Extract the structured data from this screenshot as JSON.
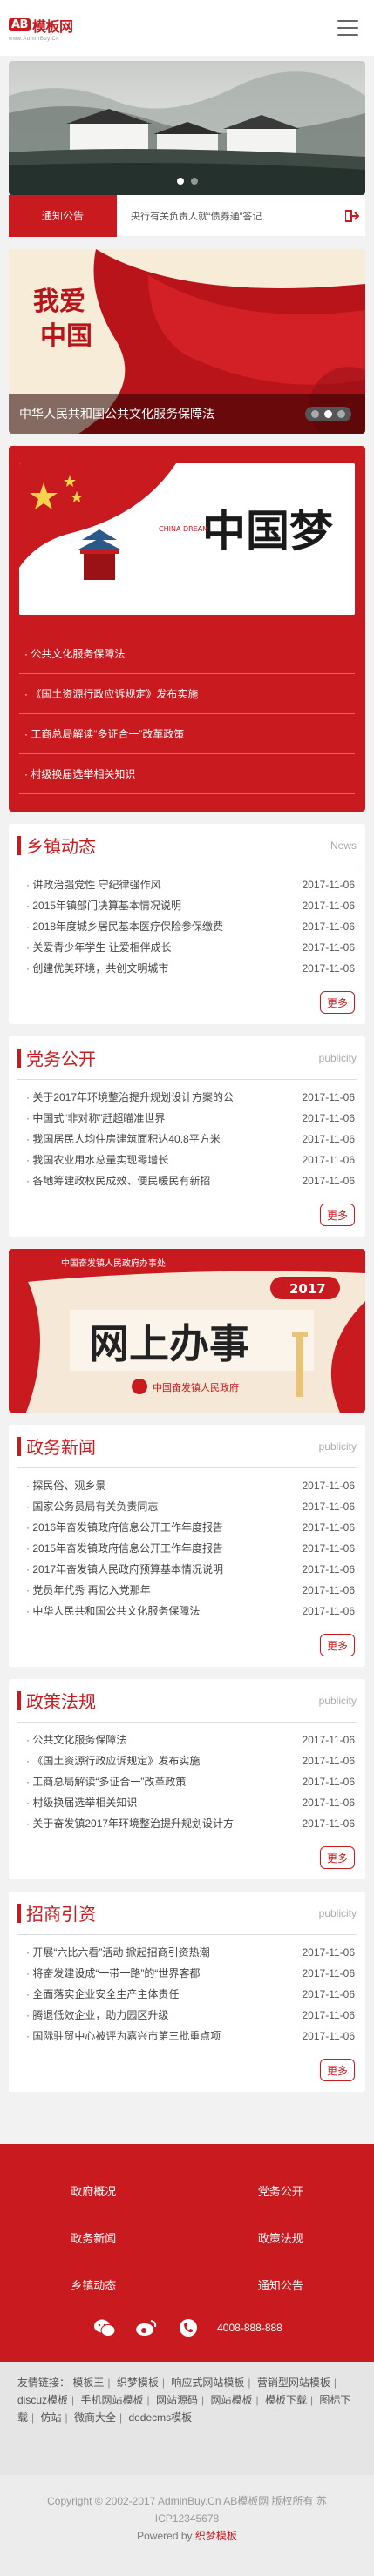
{
  "header": {
    "logo_badge": "AB",
    "logo_text": "模板网",
    "logo_sub": "www.AdminBuy.Cn"
  },
  "notice": {
    "tag": "通知公告",
    "text": "央行有关负责人就“债券通”答记"
  },
  "promo": {
    "caption": "中华人民共和国公共文化服务保障法"
  },
  "feature": {
    "image_text_big": "中国梦",
    "image_text_en": "CHINA DREAM",
    "items": [
      "公共文化服务保障法",
      "《国土资源行政应诉规定》发布实施",
      "工商总局解读“多证合一”改革政策",
      "村级换届选举相关知识"
    ]
  },
  "sections": [
    {
      "title": "乡镇动态",
      "en": "News",
      "items": [
        {
          "t": "讲政治强党性 守纪律强作风",
          "d": "2017-11-06"
        },
        {
          "t": "2015年镇部门决算基本情况说明",
          "d": "2017-11-06"
        },
        {
          "t": "2018年度城乡居民基本医疗保险参保缴费",
          "d": "2017-11-06"
        },
        {
          "t": "关爱青少年学生 让爱相伴成长",
          "d": "2017-11-06"
        },
        {
          "t": "创建优美环境，共创文明城市",
          "d": "2017-11-06"
        }
      ],
      "more": "更多"
    },
    {
      "title": "党务公开",
      "en": "publicity",
      "items": [
        {
          "t": "关于2017年环境整治提升规划设计方案的公",
          "d": "2017-11-06"
        },
        {
          "t": "中国式“非对称”赶超瞄准世界",
          "d": "2017-11-06"
        },
        {
          "t": "我国居民人均住房建筑面积达40.8平方米",
          "d": "2017-11-06"
        },
        {
          "t": "我国农业用水总量实现零增长",
          "d": "2017-11-06"
        },
        {
          "t": "各地筹建政权民成效、便民暖民有新招",
          "d": "2017-11-06"
        }
      ],
      "more": "更多"
    },
    {
      "title": "政务新闻",
      "en": "publicity",
      "items": [
        {
          "t": "探民俗、观乡景",
          "d": "2017-11-06"
        },
        {
          "t": "国家公务员局有关负责同志",
          "d": "2017-11-06"
        },
        {
          "t": "2016年奋发镇政府信息公开工作年度报告",
          "d": "2017-11-06"
        },
        {
          "t": "2015年奋发镇政府信息公开工作年度报告",
          "d": "2017-11-06"
        },
        {
          "t": "2017年奋发镇人民政府预算基本情况说明",
          "d": "2017-11-06"
        },
        {
          "t": "党员年代秀 再忆入党那年",
          "d": "2017-11-06"
        },
        {
          "t": "中华人民共和国公共文化服务保障法",
          "d": "2017-11-06"
        }
      ],
      "more": "更多"
    },
    {
      "title": "政策法规",
      "en": "publicity",
      "items": [
        {
          "t": "公共文化服务保障法",
          "d": "2017-11-06"
        },
        {
          "t": "《国土资源行政应诉规定》发布实施",
          "d": "2017-11-06"
        },
        {
          "t": "工商总局解读“多证合一”改革政策",
          "d": "2017-11-06"
        },
        {
          "t": "村级换届选举相关知识",
          "d": "2017-11-06"
        },
        {
          "t": "关于奋发镇2017年环境整治提升规划设计方",
          "d": "2017-11-06"
        }
      ],
      "more": "更多"
    },
    {
      "title": "招商引资",
      "en": "publicity",
      "items": [
        {
          "t": "开展“六比六看”活动 掀起招商引资热潮",
          "d": "2017-11-06"
        },
        {
          "t": "将奋发建设成“一带一路”的“世界客都",
          "d": "2017-11-06"
        },
        {
          "t": "全面落实企业安全生产主体责任",
          "d": "2017-11-06"
        },
        {
          "t": "腾退低效企业，助力园区升级",
          "d": "2017-11-06"
        },
        {
          "t": "国际驻贸中心被评为嘉兴市第三批重点项",
          "d": "2017-11-06"
        }
      ],
      "more": "更多"
    }
  ],
  "banner2": {
    "small": "中国奋发镇人民政府办事处",
    "year": "2017",
    "big": "网上办事",
    "seal": "中国奋发镇人民政府"
  },
  "footer_nav": {
    "items": [
      "政府概况",
      "党务公开",
      "政务新闻",
      "政策法规",
      "乡镇动态",
      "通知公告"
    ],
    "phone": "4008-888-888"
  },
  "links": {
    "label": "友情链接：",
    "items": [
      "模板王",
      "织梦模板",
      "响应式网站模板",
      "营销型网站模板",
      "discuz模板",
      "手机网站模板",
      "网站源码",
      "网站模板",
      "模板下载",
      "图标下载",
      "仿站",
      "微商大全",
      "dedecms模板"
    ]
  },
  "copyright": {
    "line1": "Copyright © 2002-2017 AdminBuy.Cn AB模板网 版权所有 苏",
    "line2": "ICP12345678",
    "powered": "Powered by",
    "powered_brand": "织梦模板"
  },
  "colors": {
    "accent": "#c81a1f"
  }
}
